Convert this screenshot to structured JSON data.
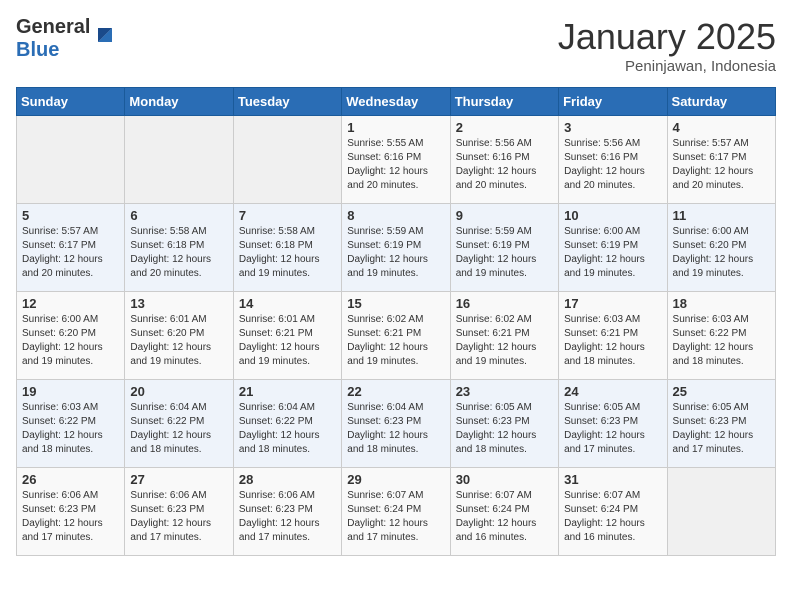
{
  "header": {
    "logo_general": "General",
    "logo_blue": "Blue",
    "month": "January 2025",
    "location": "Peninjawan, Indonesia"
  },
  "weekdays": [
    "Sunday",
    "Monday",
    "Tuesday",
    "Wednesday",
    "Thursday",
    "Friday",
    "Saturday"
  ],
  "weeks": [
    [
      {
        "day": "",
        "content": ""
      },
      {
        "day": "",
        "content": ""
      },
      {
        "day": "",
        "content": ""
      },
      {
        "day": "1",
        "content": "Sunrise: 5:55 AM\nSunset: 6:16 PM\nDaylight: 12 hours\nand 20 minutes."
      },
      {
        "day": "2",
        "content": "Sunrise: 5:56 AM\nSunset: 6:16 PM\nDaylight: 12 hours\nand 20 minutes."
      },
      {
        "day": "3",
        "content": "Sunrise: 5:56 AM\nSunset: 6:16 PM\nDaylight: 12 hours\nand 20 minutes."
      },
      {
        "day": "4",
        "content": "Sunrise: 5:57 AM\nSunset: 6:17 PM\nDaylight: 12 hours\nand 20 minutes."
      }
    ],
    [
      {
        "day": "5",
        "content": "Sunrise: 5:57 AM\nSunset: 6:17 PM\nDaylight: 12 hours\nand 20 minutes."
      },
      {
        "day": "6",
        "content": "Sunrise: 5:58 AM\nSunset: 6:18 PM\nDaylight: 12 hours\nand 20 minutes."
      },
      {
        "day": "7",
        "content": "Sunrise: 5:58 AM\nSunset: 6:18 PM\nDaylight: 12 hours\nand 19 minutes."
      },
      {
        "day": "8",
        "content": "Sunrise: 5:59 AM\nSunset: 6:19 PM\nDaylight: 12 hours\nand 19 minutes."
      },
      {
        "day": "9",
        "content": "Sunrise: 5:59 AM\nSunset: 6:19 PM\nDaylight: 12 hours\nand 19 minutes."
      },
      {
        "day": "10",
        "content": "Sunrise: 6:00 AM\nSunset: 6:19 PM\nDaylight: 12 hours\nand 19 minutes."
      },
      {
        "day": "11",
        "content": "Sunrise: 6:00 AM\nSunset: 6:20 PM\nDaylight: 12 hours\nand 19 minutes."
      }
    ],
    [
      {
        "day": "12",
        "content": "Sunrise: 6:00 AM\nSunset: 6:20 PM\nDaylight: 12 hours\nand 19 minutes."
      },
      {
        "day": "13",
        "content": "Sunrise: 6:01 AM\nSunset: 6:20 PM\nDaylight: 12 hours\nand 19 minutes."
      },
      {
        "day": "14",
        "content": "Sunrise: 6:01 AM\nSunset: 6:21 PM\nDaylight: 12 hours\nand 19 minutes."
      },
      {
        "day": "15",
        "content": "Sunrise: 6:02 AM\nSunset: 6:21 PM\nDaylight: 12 hours\nand 19 minutes."
      },
      {
        "day": "16",
        "content": "Sunrise: 6:02 AM\nSunset: 6:21 PM\nDaylight: 12 hours\nand 19 minutes."
      },
      {
        "day": "17",
        "content": "Sunrise: 6:03 AM\nSunset: 6:21 PM\nDaylight: 12 hours\nand 18 minutes."
      },
      {
        "day": "18",
        "content": "Sunrise: 6:03 AM\nSunset: 6:22 PM\nDaylight: 12 hours\nand 18 minutes."
      }
    ],
    [
      {
        "day": "19",
        "content": "Sunrise: 6:03 AM\nSunset: 6:22 PM\nDaylight: 12 hours\nand 18 minutes."
      },
      {
        "day": "20",
        "content": "Sunrise: 6:04 AM\nSunset: 6:22 PM\nDaylight: 12 hours\nand 18 minutes."
      },
      {
        "day": "21",
        "content": "Sunrise: 6:04 AM\nSunset: 6:22 PM\nDaylight: 12 hours\nand 18 minutes."
      },
      {
        "day": "22",
        "content": "Sunrise: 6:04 AM\nSunset: 6:23 PM\nDaylight: 12 hours\nand 18 minutes."
      },
      {
        "day": "23",
        "content": "Sunrise: 6:05 AM\nSunset: 6:23 PM\nDaylight: 12 hours\nand 18 minutes."
      },
      {
        "day": "24",
        "content": "Sunrise: 6:05 AM\nSunset: 6:23 PM\nDaylight: 12 hours\nand 17 minutes."
      },
      {
        "day": "25",
        "content": "Sunrise: 6:05 AM\nSunset: 6:23 PM\nDaylight: 12 hours\nand 17 minutes."
      }
    ],
    [
      {
        "day": "26",
        "content": "Sunrise: 6:06 AM\nSunset: 6:23 PM\nDaylight: 12 hours\nand 17 minutes."
      },
      {
        "day": "27",
        "content": "Sunrise: 6:06 AM\nSunset: 6:23 PM\nDaylight: 12 hours\nand 17 minutes."
      },
      {
        "day": "28",
        "content": "Sunrise: 6:06 AM\nSunset: 6:23 PM\nDaylight: 12 hours\nand 17 minutes."
      },
      {
        "day": "29",
        "content": "Sunrise: 6:07 AM\nSunset: 6:24 PM\nDaylight: 12 hours\nand 17 minutes."
      },
      {
        "day": "30",
        "content": "Sunrise: 6:07 AM\nSunset: 6:24 PM\nDaylight: 12 hours\nand 16 minutes."
      },
      {
        "day": "31",
        "content": "Sunrise: 6:07 AM\nSunset: 6:24 PM\nDaylight: 12 hours\nand 16 minutes."
      },
      {
        "day": "",
        "content": ""
      }
    ]
  ]
}
